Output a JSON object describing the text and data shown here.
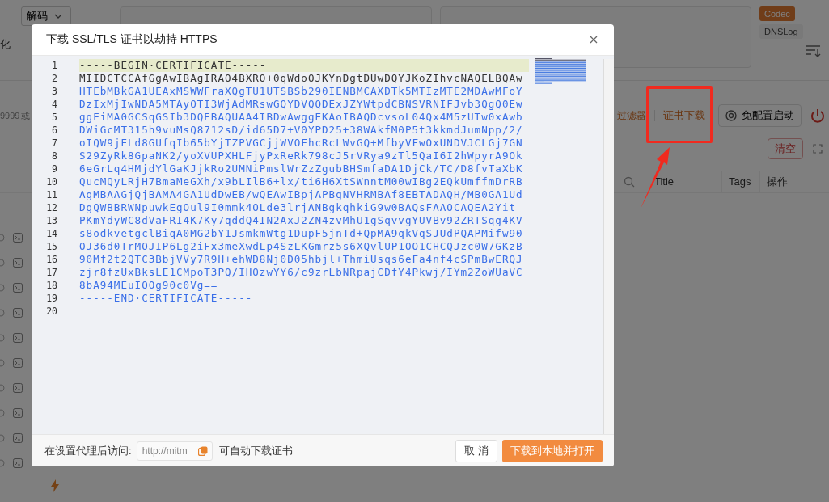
{
  "background": {
    "decode_select": {
      "label": "解码"
    },
    "edge_char": "化",
    "right_tags": [
      {
        "label": "Codec",
        "selected": true
      },
      {
        "label": "DNSLog",
        "selected": false
      }
    ],
    "filter_hint": "9999 或",
    "toolbar": {
      "filter_link": "过滤器",
      "cert_link": "证书下载",
      "launch_button": "免配置启动"
    },
    "clear_button": "清空",
    "columns": [
      "Title",
      "Tags",
      "操作"
    ]
  },
  "dialog": {
    "title": "下载 SSL/TLS 证书以劫持 HTTPS",
    "lines": [
      {
        "number": "1",
        "text": "-----BEGIN·CERTIFICATE-----",
        "kind": "plain",
        "highlighted": true
      },
      {
        "number": "2",
        "text": "MIIDCTCCAfGgAwIBAgIRAO4BXRO+0qWdoOJKYnDgtDUwDQYJKoZIhvcNAQELBQAw",
        "kind": "plain",
        "highlighted": false
      },
      {
        "number": "3",
        "text": "HTEbMBkGA1UEAxMSWWFraXQgTU1UTSBSb290IENBMCAXDTk5MTIzMTE2MDAwMFoY",
        "kind": "string",
        "highlighted": false
      },
      {
        "number": "4",
        "text": "DzIxMjIwNDA5MTAyOTI3WjAdMRswGQYDVQQDExJZYWtpdCBNSVRNIFJvb3QgQ0Ew",
        "kind": "string",
        "highlighted": false
      },
      {
        "number": "5",
        "text": "ggEiMA0GCSqGSIb3DQEBAQUAA4IBDwAwggEKAoIBAQDcvsoL04Qx4M5zUTw0xAwb",
        "kind": "string",
        "highlighted": false
      },
      {
        "number": "6",
        "text": "DWiGcMT315h9vuMsQ8712sD/id65D7+V0YPD25+38WAkfM0P5t3kkmdJumNpp/2/",
        "kind": "string",
        "highlighted": false
      },
      {
        "number": "7",
        "text": "oIQW9jELd8GUfqIb65bYjTZPVGCjjWVOFhcRcLWvGQ+MfbyVFwOxUNDVJCLGj7GN",
        "kind": "string",
        "highlighted": false
      },
      {
        "number": "8",
        "text": "S29ZyRk8GpaNK2/yoXVUPXHLFjyPxReRk798cJ5rVRya9zTl5QaI6I2hWpyrA9Ok",
        "kind": "string",
        "highlighted": false
      },
      {
        "number": "9",
        "text": "6eGrLq4HMjdYlGaKJjkRo2UMNiPmslWrZzZgubBHSmfaDA1DjCk/TC/D8fvTaXbK",
        "kind": "string",
        "highlighted": false
      },
      {
        "number": "10",
        "text": "QucMQyLRjH7BmaMeGXh/x9bLIlB6+lx/ti6H6XtSWnntM00wIBg2EQkUmffmDrRB",
        "kind": "string",
        "highlighted": false
      },
      {
        "number": "11",
        "text": "AgMBAAGjQjBAMA4GA1UdDwEB/wQEAwIBpjAPBgNVHRMBAf8EBTADAQH/MB0GA1Ud",
        "kind": "string",
        "highlighted": false
      },
      {
        "number": "12",
        "text": "DgQWBBRWNpuwkEgOul9I0mmk4OLde3lrjANBgkqhkiG9w0BAQsFAAOCAQEA2Yit",
        "kind": "string",
        "highlighted": false
      },
      {
        "number": "13",
        "text": "PKmYdyWC8dVaFRI4K7Ky7qddQ4IN2AxJ2ZN4zvMhU1gSqvvgYUVBv92ZRTSqg4KV",
        "kind": "string",
        "highlighted": false
      },
      {
        "number": "14",
        "text": "s8odkvetgclBiqA0MG2bY1JsmkmWtg1DupF5jnTd+QpMA9qkVqSJUdPQAPMifw90",
        "kind": "string",
        "highlighted": false
      },
      {
        "number": "15",
        "text": "OJ36d0TrMOJIP6Lg2iFx3meXwdLp4SzLKGmrz5s6XQvlUP1OO1CHCQJzc0W7GKzB",
        "kind": "string",
        "highlighted": false
      },
      {
        "number": "16",
        "text": "90Mf2t2QTC3BbjVVy7R9H+ehWD8Nj0D05hbjl+ThmiUsqs6eFa4nf4cSPmBwERQJ",
        "kind": "string",
        "highlighted": false
      },
      {
        "number": "17",
        "text": "zjr8fzUxBksLE1CMpoT3PQ/IHOzwYY6/c9zrLbNRpajCDfY4Pkwj/IYm2ZoWUaVC",
        "kind": "string",
        "highlighted": false
      },
      {
        "number": "18",
        "text": "8bA94MEuIQOg90c0Vg==",
        "kind": "string",
        "highlighted": false
      },
      {
        "number": "19",
        "text": "-----END·CERTIFICATE-----",
        "kind": "string",
        "highlighted": false
      },
      {
        "number": "20",
        "kind": "string",
        "highlighted": false
      }
    ],
    "footer": {
      "label": "在设置代理后访问:",
      "url_field": {
        "value": "http://mitm"
      },
      "hint": "可自动下载证书",
      "cancel_button": "取 消",
      "download_button": "下载到本地并打开"
    }
  }
}
